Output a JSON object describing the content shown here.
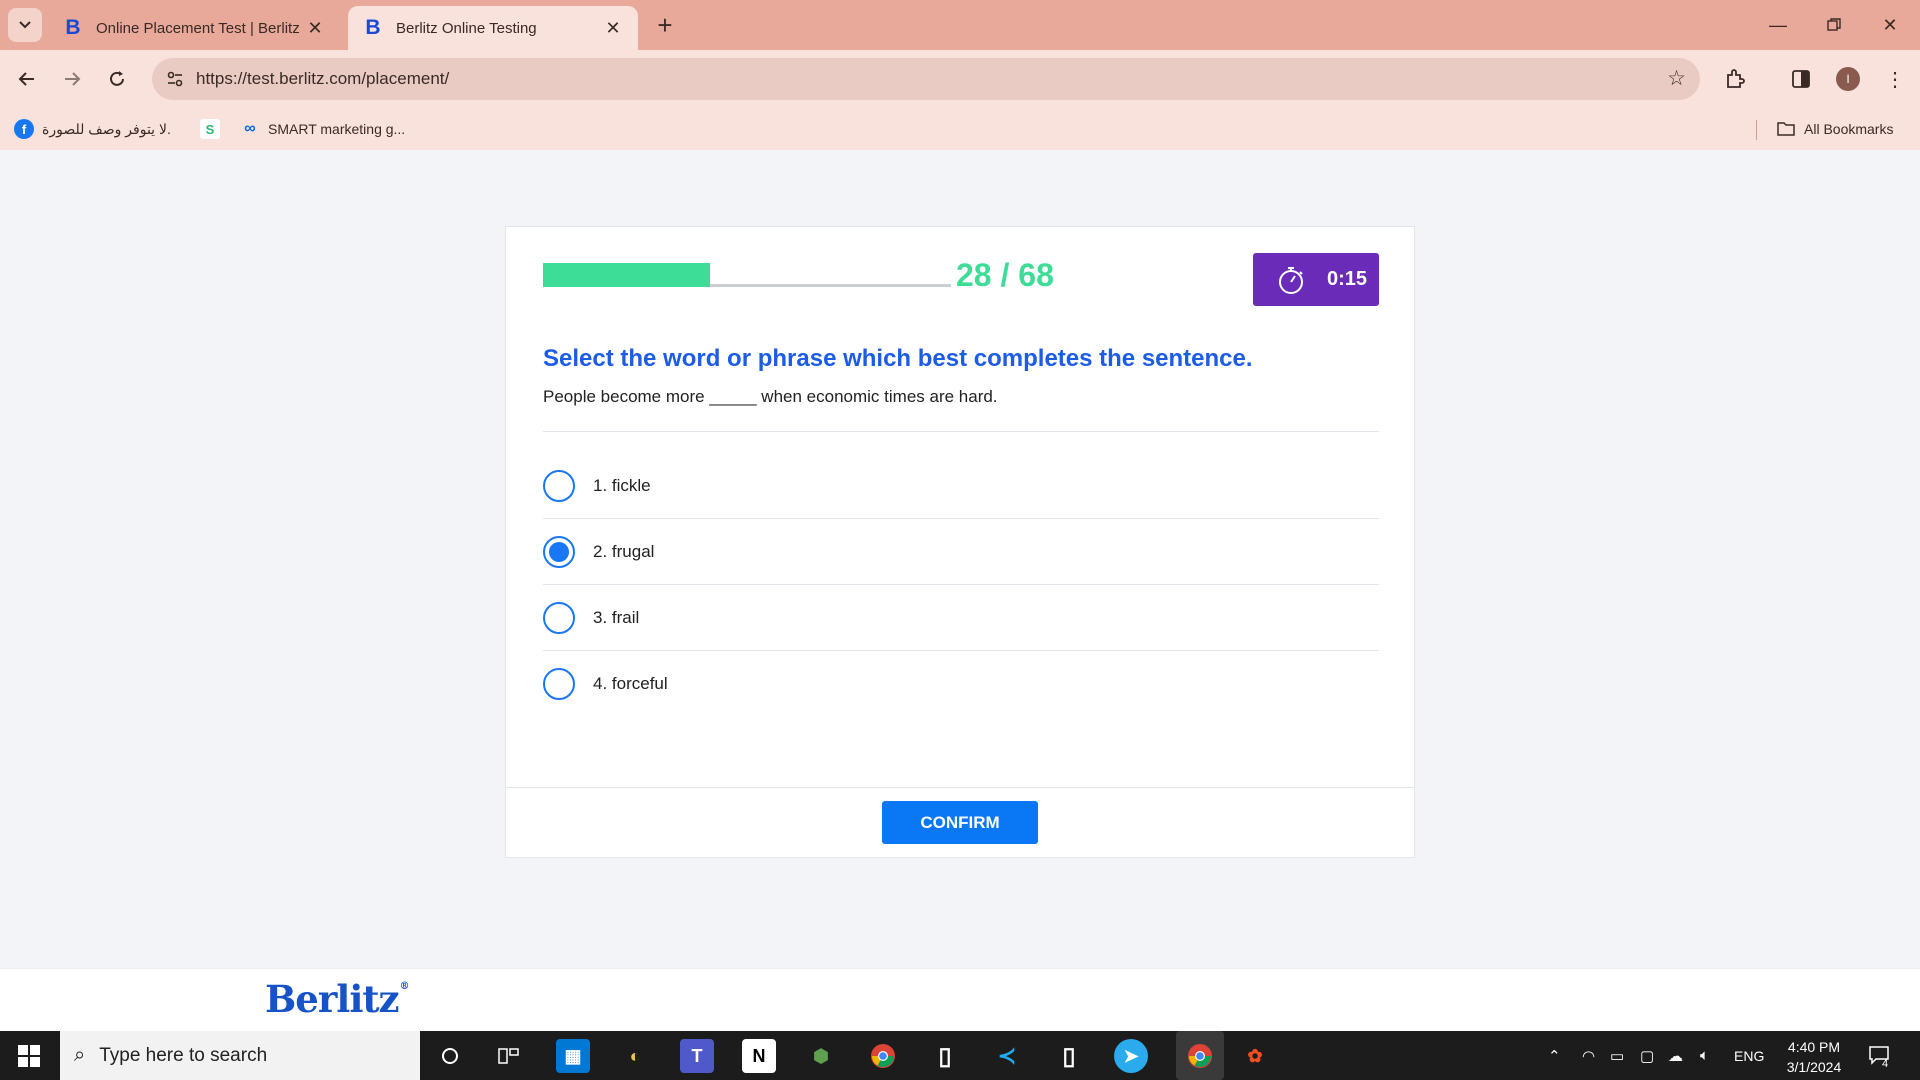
{
  "browser": {
    "tabs": [
      {
        "title": "Online Placement Test | Berlitz",
        "favicon": "B",
        "active": false
      },
      {
        "title": "Berlitz Online Testing",
        "favicon": "B",
        "active": true
      }
    ],
    "url": "https://test.berlitz.com/placement/",
    "bookmarks": [
      {
        "label": "لا يتوفر وصف للصورة.",
        "icon": "facebook-icon"
      },
      {
        "label": "",
        "icon": "s-app-icon"
      },
      {
        "label": "SMART marketing g...",
        "icon": "meta-icon"
      }
    ],
    "all_bookmarks_label": "All Bookmarks",
    "profile_initial": "I"
  },
  "test": {
    "progress": {
      "current": "28",
      "separator": "/",
      "total": "68",
      "fraction": 0.41
    },
    "timer": "0:15",
    "question_title": "Select the word or phrase which best completes the sentence.",
    "sentence": "People become more _____ when economic times are hard.",
    "options": [
      {
        "label": "1. fickle",
        "selected": false
      },
      {
        "label": "2. frugal",
        "selected": true
      },
      {
        "label": "3. frail",
        "selected": false
      },
      {
        "label": "4. forceful",
        "selected": false
      }
    ],
    "confirm_label": "CONFIRM"
  },
  "footer": {
    "logo": "Berlitz",
    "registered": "®"
  },
  "taskbar": {
    "search_placeholder": "Type here to search",
    "language": "ENG",
    "time": "4:40 PM",
    "date": "3/1/2024",
    "notifications": "4"
  },
  "colors": {
    "accent_green": "#3ddc97",
    "question_blue": "#1c5ce6",
    "timer_purple": "#6a2bb8",
    "confirm_blue": "#0a78f5",
    "chrome_tab": "#e8a89a"
  }
}
